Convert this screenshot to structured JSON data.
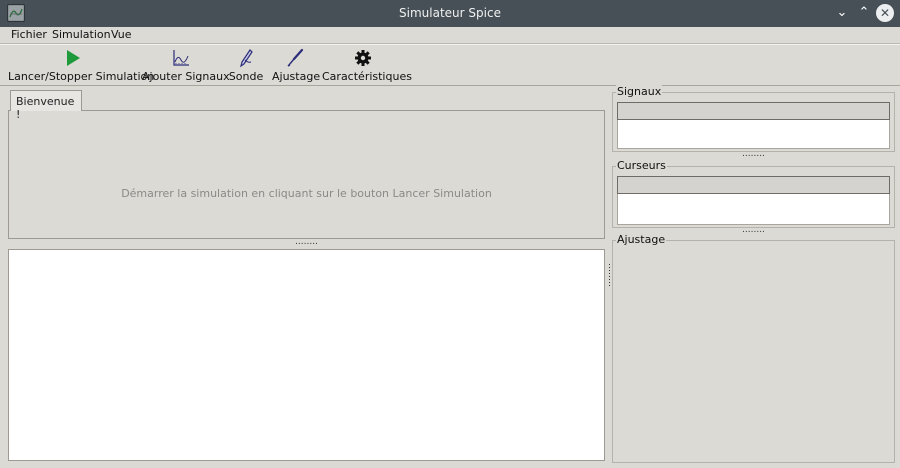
{
  "window": {
    "title": "Simulateur Spice",
    "min_glyph": "⌄",
    "max_glyph": "⌃",
    "close_glyph": "✕",
    "icon": "app-scope-icon"
  },
  "menubar": {
    "items": [
      {
        "label": "Fichier"
      },
      {
        "label": "Simulation"
      },
      {
        "label": "Vue"
      }
    ]
  },
  "toolbar": {
    "tools": [
      {
        "label": "Lancer/Stopper Simulation",
        "icon": "play-icon",
        "color": "#1f9a3a"
      },
      {
        "label": "Ajouter Signaux",
        "icon": "chart-icon",
        "color": "#2b2d7a"
      },
      {
        "label": "Sonde",
        "icon": "probe-icon",
        "color": "#2b2d7a"
      },
      {
        "label": "Ajustage",
        "icon": "tuning-icon",
        "color": "#2b2d7a"
      },
      {
        "label": "Caractéristiques",
        "icon": "gear-icon",
        "color": "#111111"
      }
    ]
  },
  "tabs": {
    "active": "Bienvenue !",
    "welcome_text": "Démarrer la simulation en cliquant sur le bouton Lancer Simulation"
  },
  "splitter": {
    "glyph": "........"
  },
  "panels": {
    "signals": {
      "title": "Signaux"
    },
    "cursors": {
      "title": "Curseurs"
    },
    "adjust": {
      "title": "Ajustage"
    }
  },
  "colors": {
    "titlebar": "#475057",
    "window_bg": "#dcdad5",
    "play": "#1f9a3a"
  }
}
